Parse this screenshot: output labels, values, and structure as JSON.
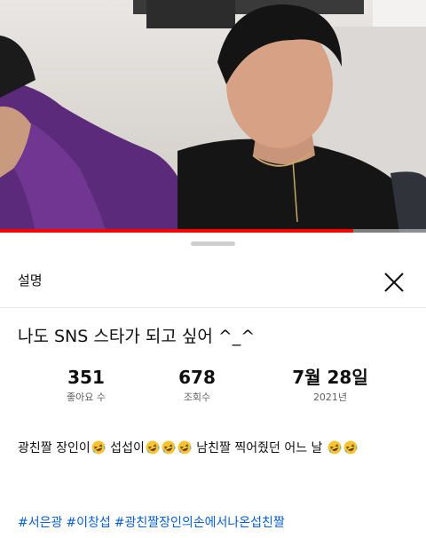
{
  "video": {
    "progress_fraction": 0.83
  },
  "sheet": {
    "title": "설명",
    "close_icon": "close-x-icon"
  },
  "video_title": "나도 SNS 스타가 되고 싶어 ^_^",
  "stats": {
    "likes": {
      "value": "351",
      "label": "좋아요 수"
    },
    "views": {
      "value": "678",
      "label": "조회수"
    },
    "date": {
      "value": "7월 28일",
      "label": "2021년"
    }
  },
  "description": {
    "part1": "광친짤 장인이",
    "part2": " 섭섭이",
    "part3": " 남친짤 찍어줬던 어느 날 ",
    "emoji_icon": "rolling-on-floor-laughing-emoji"
  },
  "hashtags": [
    "#서은광",
    "#이창섭",
    "#광친짤장인의손에서나온섭친짤"
  ],
  "colors": {
    "progress": "#ff0000",
    "hashtag": "#065fd4",
    "emoji_face": "#f7c531"
  }
}
